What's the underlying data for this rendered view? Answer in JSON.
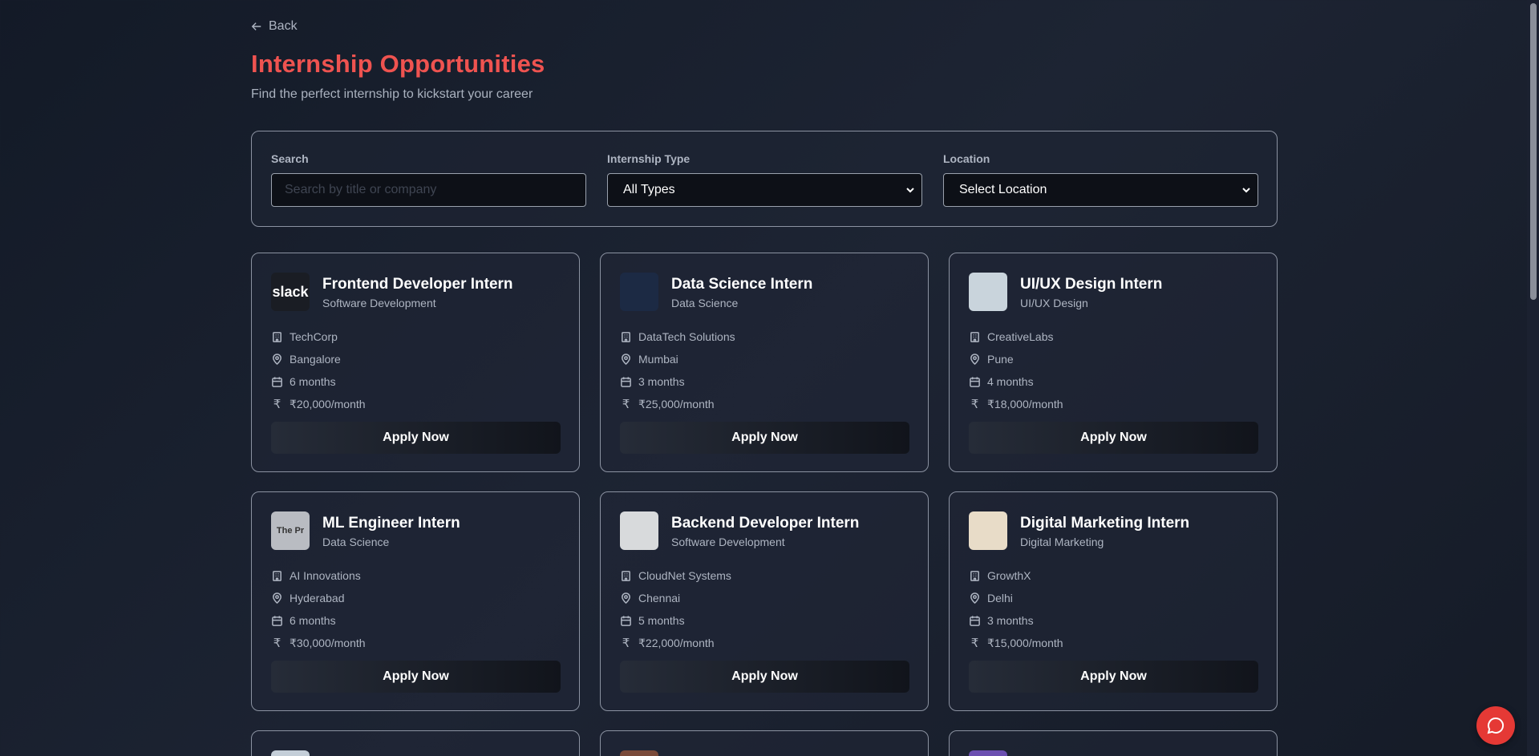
{
  "nav": {
    "back_label": "Back"
  },
  "header": {
    "title": "Internship Opportunities",
    "subtitle": "Find the perfect internship to kickstart your career"
  },
  "filters": {
    "search_label": "Search",
    "search_placeholder": "Search by title or company",
    "type_label": "Internship Type",
    "type_value": "All Types",
    "location_label": "Location",
    "location_value": "Select Location"
  },
  "cards": [
    {
      "title": "Frontend Developer Intern",
      "category": "Software Development",
      "company": "TechCorp",
      "location": "Bangalore",
      "duration": "6 months",
      "stipend": "₹20,000/month",
      "apply": "Apply Now",
      "logo_text": "slack",
      "logo_color": "#1a1d24"
    },
    {
      "title": "Data Science Intern",
      "category": "Data Science",
      "company": "DataTech Solutions",
      "location": "Mumbai",
      "duration": "3 months",
      "stipend": "₹25,000/month",
      "apply": "Apply Now",
      "logo_color": "#1c2a44"
    },
    {
      "title": "UI/UX Design Intern",
      "category": "UI/UX Design",
      "company": "CreativeLabs",
      "location": "Pune",
      "duration": "4 months",
      "stipend": "₹18,000/month",
      "apply": "Apply Now",
      "logo_color": "#c9d4dc"
    },
    {
      "title": "ML Engineer Intern",
      "category": "Data Science",
      "company": "AI Innovations",
      "location": "Hyderabad",
      "duration": "6 months",
      "stipend": "₹30,000/month",
      "apply": "Apply Now",
      "logo_text": "The Pr",
      "logo_color": "#b9bcc2"
    },
    {
      "title": "Backend Developer Intern",
      "category": "Software Development",
      "company": "CloudNet Systems",
      "location": "Chennai",
      "duration": "5 months",
      "stipend": "₹22,000/month",
      "apply": "Apply Now",
      "logo_color": "#d8dadc"
    },
    {
      "title": "Digital Marketing Intern",
      "category": "Digital Marketing",
      "company": "GrowthX",
      "location": "Delhi",
      "duration": "3 months",
      "stipend": "₹15,000/month",
      "apply": "Apply Now",
      "logo_color": "#e8dcc8"
    }
  ],
  "colors": {
    "accent": "#ef5350",
    "chat_button": "#e53935",
    "background": "#1a2030"
  },
  "icons": [
    "arrow-left-icon",
    "building-icon",
    "map-pin-icon",
    "calendar-icon",
    "rupee-icon",
    "chevron-down-icon",
    "chat-icon"
  ]
}
